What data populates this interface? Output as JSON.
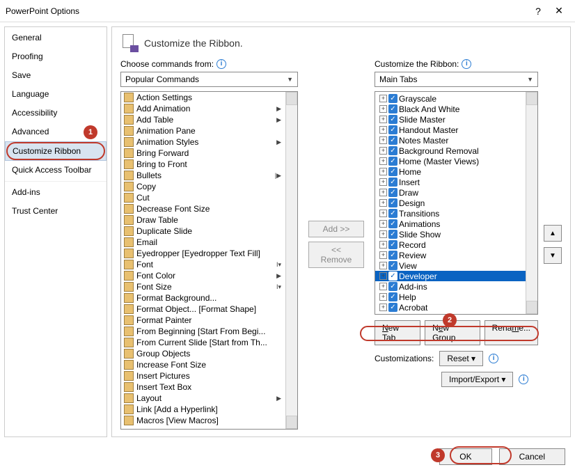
{
  "titlebar": {
    "title": "PowerPoint Options"
  },
  "sidebar": {
    "items": [
      {
        "label": "General"
      },
      {
        "label": "Proofing"
      },
      {
        "label": "Save"
      },
      {
        "label": "Language"
      },
      {
        "label": "Accessibility"
      },
      {
        "label": "Advanced"
      },
      {
        "label": "Customize Ribbon",
        "selected": true
      },
      {
        "label": "Quick Access Toolbar"
      },
      {
        "label": "Add-ins",
        "sep": true
      },
      {
        "label": "Trust Center"
      }
    ]
  },
  "header": {
    "title": "Customize the Ribbon."
  },
  "left_combo": {
    "label": "Choose commands from:",
    "value": "Popular Commands"
  },
  "right_combo": {
    "label": "Customize the Ribbon:",
    "value": "Main Tabs"
  },
  "commands": [
    {
      "label": "Action Settings"
    },
    {
      "label": "Add Animation",
      "sub": "▶"
    },
    {
      "label": "Add Table",
      "sub": "▶"
    },
    {
      "label": "Animation Pane"
    },
    {
      "label": "Animation Styles",
      "sub": "▶"
    },
    {
      "label": "Bring Forward"
    },
    {
      "label": "Bring to Front"
    },
    {
      "label": "Bullets",
      "sub": "|▶"
    },
    {
      "label": "Copy"
    },
    {
      "label": "Cut"
    },
    {
      "label": "Decrease Font Size"
    },
    {
      "label": "Draw Table"
    },
    {
      "label": "Duplicate Slide"
    },
    {
      "label": "Email"
    },
    {
      "label": "Eyedropper [Eyedropper Text Fill]"
    },
    {
      "label": "Font",
      "sub": "I▾"
    },
    {
      "label": "Font Color",
      "sub": "▶"
    },
    {
      "label": "Font Size",
      "sub": "I▾"
    },
    {
      "label": "Format Background..."
    },
    {
      "label": "Format Object... [Format Shape]"
    },
    {
      "label": "Format Painter"
    },
    {
      "label": "From Beginning [Start From Begi..."
    },
    {
      "label": "From Current Slide [Start from Th..."
    },
    {
      "label": "Group Objects"
    },
    {
      "label": "Increase Font Size"
    },
    {
      "label": "Insert Pictures"
    },
    {
      "label": "Insert Text Box"
    },
    {
      "label": "Layout",
      "sub": "▶"
    },
    {
      "label": "Link [Add a Hyperlink]"
    },
    {
      "label": "Macros [View Macros]"
    }
  ],
  "tabs": [
    {
      "label": "Grayscale"
    },
    {
      "label": "Black And White"
    },
    {
      "label": "Slide Master"
    },
    {
      "label": "Handout Master"
    },
    {
      "label": "Notes Master"
    },
    {
      "label": "Background Removal"
    },
    {
      "label": "Home (Master Views)"
    },
    {
      "label": "Home"
    },
    {
      "label": "Insert"
    },
    {
      "label": "Draw"
    },
    {
      "label": "Design"
    },
    {
      "label": "Transitions"
    },
    {
      "label": "Animations"
    },
    {
      "label": "Slide Show"
    },
    {
      "label": "Record"
    },
    {
      "label": "Review"
    },
    {
      "label": "View"
    },
    {
      "label": "Developer",
      "selected": true
    },
    {
      "label": "Add-ins"
    },
    {
      "label": "Help"
    },
    {
      "label": "Acrobat"
    }
  ],
  "mid": {
    "add": "Add >>",
    "remove": "<< Remove"
  },
  "rbtns": {
    "newtab": "New Tab",
    "newgroup": "New Group",
    "rename": "Rename..."
  },
  "cust": {
    "label": "Customizations:",
    "reset": "Reset ▾",
    "import": "Import/Export ▾"
  },
  "footer": {
    "ok": "OK",
    "cancel": "Cancel"
  },
  "callouts": {
    "c1": "1",
    "c2": "2",
    "c3": "3"
  }
}
